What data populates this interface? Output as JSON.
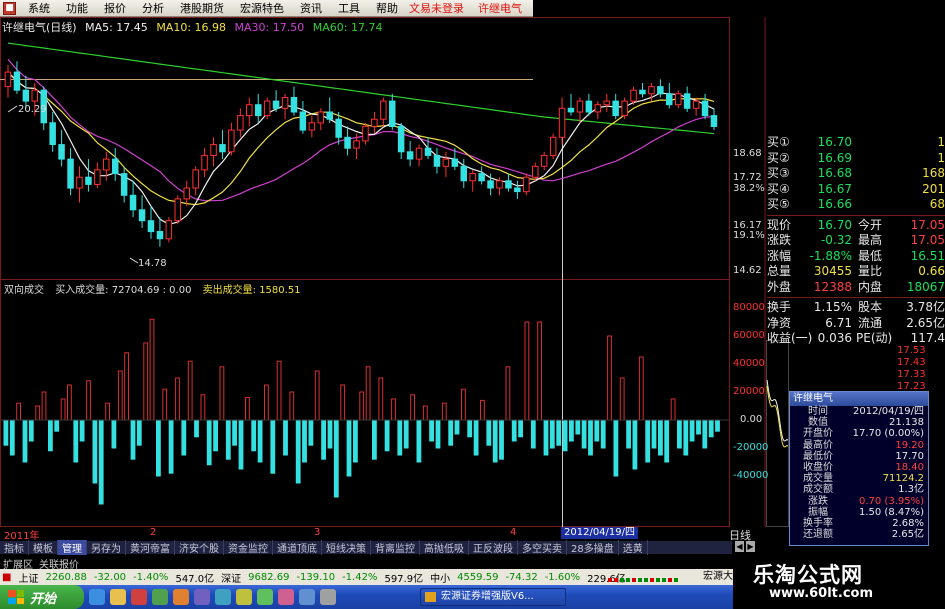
{
  "menu": {
    "items": [
      "系统",
      "功能",
      "报价",
      "分析",
      "港股期货",
      "宏源特色",
      "资讯",
      "工具",
      "帮助"
    ],
    "links": [
      "文易未登录",
      "许继电气"
    ]
  },
  "price_chart": {
    "title_parts": [
      {
        "text": "许继电气(日线)",
        "color": "#e8e8e8"
      },
      {
        "text": "MA5: 17.45",
        "color": "#f0f0f0"
      },
      {
        "text": "MA10: 16.98",
        "color": "#f0e040"
      },
      {
        "text": "MA30: 17.50",
        "color": "#d040d0"
      },
      {
        "text": "MA60: 17.74",
        "color": "#30d030"
      }
    ],
    "high_label": "20.29",
    "low_label": "14.78",
    "axis_labels": [
      {
        "text": "18.68",
        "color": "#ff3030"
      },
      {
        "text": "17.72",
        "color": "#ff3030"
      },
      {
        "text": "38.2%",
        "color": "#ff3030"
      },
      {
        "text": "16.17",
        "color": "#ff3030"
      },
      {
        "text": "19.1%",
        "color": "#ff3030"
      },
      {
        "text": "14.62",
        "color": "#ff3030"
      }
    ],
    "candles": [
      [
        19.2,
        19.8,
        18.9,
        19.6
      ],
      [
        19.6,
        19.9,
        19.0,
        19.1
      ],
      [
        19.1,
        19.5,
        18.6,
        18.8
      ],
      [
        18.8,
        19.3,
        18.4,
        19.1
      ],
      [
        19.1,
        19.2,
        18.0,
        18.2
      ],
      [
        18.2,
        18.5,
        17.4,
        17.6
      ],
      [
        17.6,
        18.0,
        17.0,
        17.2
      ],
      [
        17.2,
        17.5,
        16.2,
        16.4
      ],
      [
        16.4,
        17.0,
        16.0,
        16.7
      ],
      [
        16.7,
        17.2,
        16.3,
        16.5
      ],
      [
        16.5,
        17.1,
        16.4,
        16.9
      ],
      [
        16.9,
        17.4,
        16.6,
        17.2
      ],
      [
        17.2,
        17.5,
        16.6,
        16.8
      ],
      [
        16.8,
        17.0,
        16.0,
        16.2
      ],
      [
        16.2,
        16.6,
        15.6,
        15.8
      ],
      [
        15.8,
        16.2,
        15.3,
        15.5
      ],
      [
        15.5,
        15.9,
        15.0,
        15.2
      ],
      [
        15.2,
        15.6,
        14.78,
        15.0
      ],
      [
        15.0,
        15.6,
        14.9,
        15.5
      ],
      [
        15.5,
        16.2,
        15.4,
        16.1
      ],
      [
        16.1,
        16.6,
        15.9,
        16.4
      ],
      [
        16.4,
        17.0,
        16.2,
        16.9
      ],
      [
        16.9,
        17.5,
        16.7,
        17.3
      ],
      [
        17.3,
        17.8,
        17.0,
        17.6
      ],
      [
        17.6,
        18.0,
        17.2,
        17.4
      ],
      [
        17.4,
        18.2,
        17.3,
        18.0
      ],
      [
        18.0,
        18.6,
        17.8,
        18.4
      ],
      [
        18.4,
        18.9,
        18.1,
        18.7
      ],
      [
        18.7,
        19.0,
        18.2,
        18.4
      ],
      [
        18.4,
        18.9,
        18.3,
        18.8
      ],
      [
        18.8,
        19.1,
        18.5,
        18.6
      ],
      [
        18.6,
        19.0,
        18.3,
        18.9
      ],
      [
        18.9,
        19.2,
        18.4,
        18.5
      ],
      [
        18.5,
        18.8,
        17.9,
        18.0
      ],
      [
        18.0,
        18.4,
        17.8,
        18.2
      ],
      [
        18.2,
        18.6,
        18.0,
        18.5
      ],
      [
        18.5,
        18.9,
        18.2,
        18.3
      ],
      [
        18.3,
        18.5,
        17.6,
        17.8
      ],
      [
        17.8,
        18.1,
        17.3,
        17.5
      ],
      [
        17.5,
        17.9,
        17.2,
        17.7
      ],
      [
        17.7,
        18.2,
        17.6,
        18.1
      ],
      [
        18.1,
        18.5,
        17.9,
        18.3
      ],
      [
        18.3,
        18.9,
        18.1,
        18.8
      ],
      [
        18.8,
        19.0,
        18.0,
        18.1
      ],
      [
        18.1,
        18.2,
        17.2,
        17.4
      ],
      [
        17.4,
        17.7,
        17.0,
        17.2
      ],
      [
        17.2,
        17.6,
        17.0,
        17.5
      ],
      [
        17.5,
        17.8,
        17.2,
        17.3
      ],
      [
        17.3,
        17.5,
        16.8,
        17.0
      ],
      [
        17.0,
        17.4,
        16.7,
        17.2
      ],
      [
        17.2,
        17.5,
        16.9,
        17.0
      ],
      [
        17.0,
        17.2,
        16.4,
        16.6
      ],
      [
        16.6,
        16.9,
        16.3,
        16.8
      ],
      [
        16.8,
        17.0,
        16.5,
        16.6
      ],
      [
        16.6,
        16.8,
        16.2,
        16.4
      ],
      [
        16.4,
        16.7,
        16.2,
        16.6
      ],
      [
        16.6,
        16.8,
        16.3,
        16.4
      ],
      [
        16.4,
        16.6,
        16.1,
        16.3
      ],
      [
        16.3,
        16.8,
        16.2,
        16.7
      ],
      [
        16.7,
        17.1,
        16.6,
        17.0
      ],
      [
        17.0,
        17.4,
        16.9,
        17.3
      ],
      [
        17.3,
        17.9,
        17.2,
        17.8
      ],
      [
        17.8,
        18.9,
        17.6,
        18.6
      ],
      [
        18.6,
        19.0,
        18.4,
        18.5
      ],
      [
        18.5,
        18.9,
        18.2,
        18.8
      ],
      [
        18.8,
        19.0,
        18.4,
        18.5
      ],
      [
        18.5,
        18.8,
        18.3,
        18.7
      ],
      [
        18.7,
        19.0,
        18.5,
        18.8
      ],
      [
        18.8,
        19.0,
        18.3,
        18.4
      ],
      [
        18.4,
        18.9,
        18.3,
        18.8
      ],
      [
        18.8,
        19.2,
        18.7,
        19.1
      ],
      [
        19.1,
        19.3,
        18.9,
        19.0
      ],
      [
        19.0,
        19.3,
        18.8,
        19.2
      ],
      [
        19.2,
        19.4,
        18.9,
        19.0
      ],
      [
        19.0,
        19.3,
        18.6,
        18.7
      ],
      [
        18.7,
        19.1,
        18.6,
        19.0
      ],
      [
        19.0,
        19.2,
        18.5,
        18.6
      ],
      [
        18.6,
        18.9,
        18.4,
        18.8
      ],
      [
        18.8,
        19.0,
        18.3,
        18.4
      ],
      [
        18.4,
        18.6,
        18.0,
        18.1
      ]
    ]
  },
  "quote": {
    "bids": [
      {
        "label": "买①",
        "price": "16.70",
        "vol": "1"
      },
      {
        "label": "买②",
        "price": "16.69",
        "vol": "1"
      },
      {
        "label": "买③",
        "price": "16.68",
        "vol": "168"
      },
      {
        "label": "买④",
        "price": "16.67",
        "vol": "201"
      },
      {
        "label": "买⑤",
        "price": "16.66",
        "vol": "68"
      }
    ],
    "stats": [
      {
        "k1": "现价",
        "v1": "16.70",
        "c1": "green",
        "k2": "今开",
        "v2": "17.05",
        "c2": "red"
      },
      {
        "k1": "涨跌",
        "v1": "-0.32",
        "c1": "green",
        "k2": "最高",
        "v2": "17.05",
        "c2": "red"
      },
      {
        "k1": "涨幅",
        "v1": "-1.88%",
        "c1": "green",
        "k2": "最低",
        "v2": "16.51",
        "c2": "green"
      },
      {
        "k1": "总量",
        "v1": "30455",
        "c1": "yellow",
        "k2": "量比",
        "v2": "0.66",
        "c2": "yellow"
      },
      {
        "k1": "外盘",
        "v1": "12388",
        "c1": "red",
        "k2": "内盘",
        "v2": "18067",
        "c2": "green"
      }
    ],
    "fundamentals": [
      {
        "k1": "换手",
        "v1": "1.15%",
        "k2": "股本",
        "v2": "3.78亿"
      },
      {
        "k1": "净资",
        "v1": "6.71",
        "k2": "流通",
        "v2": "2.65亿"
      },
      {
        "k1": "收益(一)",
        "v1": "0.036",
        "k2": "PE(动)",
        "v2": "117.4"
      }
    ]
  },
  "volume_chart": {
    "title_parts": [
      {
        "text": "双向成交",
        "color": "#dddddd"
      },
      {
        "text": "买入成交量: 72704.69 : 0.00",
        "color": "#f0f0f0"
      },
      {
        "text": "卖出成交量: 1580.51",
        "color": "#f0e040"
      }
    ],
    "axis_labels": [
      "80000",
      "60000",
      "40000",
      "20000",
      "0.00",
      "-20000",
      "-40000"
    ],
    "bars": [
      -18000,
      -25000,
      12000,
      -30000,
      -15000,
      10000,
      20000,
      -22000,
      -8000,
      15000,
      25000,
      -30000,
      -15000,
      28000,
      -45000,
      -60000,
      12000,
      -20000,
      35000,
      48000,
      -28000,
      -18000,
      55000,
      72000,
      -40000,
      22000,
      -38000,
      30000,
      -25000,
      42000,
      -12000,
      18000,
      -32000,
      -22000,
      38000,
      -28000,
      -18000,
      -35000,
      16000,
      -22000,
      -30000,
      25000,
      -38000,
      42000,
      -25000,
      20000,
      -45000,
      -30000,
      -18000,
      35000,
      -28000,
      -20000,
      -55000,
      25000,
      -40000,
      -30000,
      20000,
      38000,
      -28000,
      30000,
      -22000,
      15000,
      -25000,
      -20000,
      18000,
      -30000,
      10000,
      -15000,
      -20000,
      12000,
      -18000,
      -10000,
      22000,
      -12000,
      -25000,
      14000,
      -18000,
      -30000,
      -28000,
      38000,
      -15000,
      -12000,
      70000,
      -20000,
      70000,
      -25000,
      -20000,
      -18000,
      -22000,
      -15000,
      -10000,
      -20000,
      -25000,
      -15000,
      -20000,
      60000,
      -40000,
      30000,
      -20000,
      -35000,
      45000,
      -30000,
      -20000,
      -25000,
      -30000,
      15000,
      -20000,
      -25000,
      -15000,
      -10000,
      -20000,
      -12000,
      -8000
    ]
  },
  "popup": {
    "title": "许继电气",
    "rows": [
      {
        "k": "时间",
        "v": "2012/04/19/四",
        "c": "white"
      },
      {
        "k": "数值",
        "v": "21.138",
        "c": "white"
      },
      {
        "k": "开盘价",
        "v": "17.70 (0.00%)",
        "c": "white"
      },
      {
        "k": "最高价",
        "v": "19.20",
        "c": "red"
      },
      {
        "k": "最低价",
        "v": "17.70",
        "c": "white"
      },
      {
        "k": "收盘价",
        "v": "18.40",
        "c": "red"
      },
      {
        "k": "成交量",
        "v": "71124.2",
        "c": "yellow"
      },
      {
        "k": "成交额",
        "v": "1.3亿",
        "c": "white"
      },
      {
        "k": "涨跌",
        "v": "0.70 (3.95%)",
        "c": "red"
      },
      {
        "k": "振幅",
        "v": "1.50 (8.47%)",
        "c": "white"
      },
      {
        "k": "换手率",
        "v": "2.68%",
        "c": "white"
      },
      {
        "k": "还退额",
        "v": "2.65亿",
        "c": "white"
      }
    ]
  },
  "mini_chart": {
    "labels": [
      "17.53",
      "17.43",
      "17.33",
      "17.23"
    ]
  },
  "date_bar": {
    "labels": [
      {
        "text": "2011年",
        "pos": 0.005
      },
      {
        "text": "2",
        "pos": 0.205
      },
      {
        "text": "3",
        "pos": 0.43
      },
      {
        "text": "4",
        "pos": 0.7
      }
    ],
    "cursor_date": "2012/04/19/四",
    "period": "日线"
  },
  "tabs": {
    "items": [
      "指标",
      "模板",
      "管理",
      "另存为",
      "黄河帝富",
      "济安个股",
      "资金监控",
      "通道顶底",
      "短线决策",
      "背离监控",
      "高抛低吸",
      "正反波段",
      "多空买卖",
      "28多操盘",
      "选黄"
    ],
    "active": "管理",
    "sub_items": [
      "扩展区",
      "关联报价"
    ]
  },
  "ticker": {
    "items": [
      {
        "name": "上证",
        "value": "2260.88",
        "chg": "-32.00",
        "pct": "-1.40%",
        "amt": "547.0亿"
      },
      {
        "name": "深证",
        "value": "9682.69",
        "chg": "-139.10",
        "pct": "-1.42%",
        "amt": "597.9亿"
      },
      {
        "name": "中小",
        "value": "4559.59",
        "chg": "-74.32",
        "pct": "-1.60%",
        "amt": "229.6亿"
      }
    ],
    "info": "宏源大连街"
  },
  "taskbar": {
    "start": "开始",
    "app": "宏源证券增强版V6..."
  },
  "watermark": {
    "title": "乐淘公式网",
    "url": "www.60lt.com"
  },
  "colors": {
    "up": "#ff3030",
    "down": "#35e0e0",
    "ma5": "#f0f0f0",
    "ma10": "#f0e040",
    "ma30": "#d040d0",
    "ma60": "#30d030",
    "frame": "#7a1a1a"
  }
}
